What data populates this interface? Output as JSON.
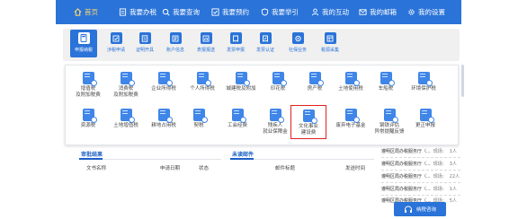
{
  "topnav": {
    "items": [
      {
        "label": "首页",
        "icon": "home-icon"
      },
      {
        "label": "我要办税",
        "icon": "document-icon"
      },
      {
        "label": "我要查询",
        "icon": "search-icon"
      },
      {
        "label": "我要预约",
        "icon": "check-icon"
      },
      {
        "label": "我要举引",
        "icon": "shield-icon"
      },
      {
        "label": "我的互动",
        "icon": "people-icon"
      },
      {
        "label": "我的邮箱",
        "icon": "mail-icon"
      },
      {
        "label": "我的设置",
        "icon": "gear-icon"
      }
    ]
  },
  "quickbar": {
    "items": [
      {
        "label": "申报纳税",
        "icon": "calculator-icon"
      },
      {
        "label": "涉税申请",
        "icon": "form-icon"
      },
      {
        "label": "证明开具",
        "icon": "certificate-icon"
      },
      {
        "label": "账户信息",
        "icon": "account-icon"
      },
      {
        "label": "表报报送",
        "icon": "report-icon"
      },
      {
        "label": "发票申报",
        "icon": "invoice-icon"
      },
      {
        "label": "发票认证",
        "icon": "invoice-check-icon"
      },
      {
        "label": "社保业务",
        "icon": "social-security-icon"
      },
      {
        "label": "税源采集",
        "icon": "collect-icon"
      }
    ]
  },
  "tax_panel": {
    "row1": [
      {
        "label": "增值税",
        "label2": "及附加税费"
      },
      {
        "label": "消费税",
        "label2": "及附加税费"
      },
      {
        "label": "企业所得税",
        "label2": ""
      },
      {
        "label": "个人所得税",
        "label2": ""
      },
      {
        "label": "城建税及附加",
        "label2": ""
      },
      {
        "label": "印花税",
        "label2": ""
      },
      {
        "label": "房产税",
        "label2": ""
      },
      {
        "label": "土地使用税",
        "label2": ""
      },
      {
        "label": "车船税",
        "label2": ""
      },
      {
        "label": "环境保护税",
        "label2": ""
      }
    ],
    "row2": [
      {
        "label": "资源税",
        "label2": ""
      },
      {
        "label": "土地增值税",
        "label2": ""
      },
      {
        "label": "耕地占用税",
        "label2": ""
      },
      {
        "label": "契税",
        "label2": ""
      },
      {
        "label": "工会经费",
        "label2": ""
      },
      {
        "label": "残疾人",
        "label2": "就业保障金"
      },
      {
        "label": "文化事业",
        "label2": "建设费"
      },
      {
        "label": "废弃电子基金",
        "label2": ""
      },
      {
        "label": "钢铁评估",
        "label2": "异常提醒反馈"
      },
      {
        "label": "更正申报",
        "label2": ""
      }
    ]
  },
  "audit": {
    "title": "审批结果",
    "headers": [
      "文书名称",
      "申请日期",
      "状态"
    ]
  },
  "mail": {
    "title": "未读邮件",
    "headers": [
      "邮件标题",
      "发送时间"
    ]
  },
  "messages": [
    {
      "text": "遵明区局办税服务厅（...",
      "status": "现场：",
      "count": "1人"
    },
    {
      "text": "遵明区局办税服务厅（...",
      "status": "现场：",
      "count": "3人"
    },
    {
      "text": "遵明区局办税服务厅（...",
      "status": "现场：",
      "count": "22人"
    },
    {
      "text": "遵明区局办税服务厅（...",
      "status": "现场：",
      "count": "1人"
    },
    {
      "text": "遵明区局办税服务厅（...",
      "status": "现场：",
      "count": "5人"
    }
  ],
  "help": {
    "label": "纳税咨询",
    "icon": "headset-icon"
  },
  "colors": {
    "primary": "#2a73d8",
    "highlight": "#e02020"
  }
}
